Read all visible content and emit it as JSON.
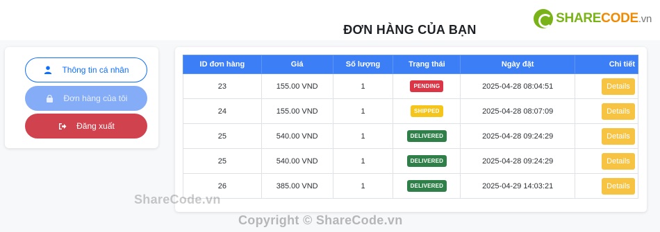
{
  "brand": {
    "share": "SHARE",
    "code": "CODE",
    "tld": ".vn"
  },
  "page": {
    "title": "ĐƠN HÀNG CỦA BẠN"
  },
  "sidebar": {
    "profile_label": "Thông tin cá nhân",
    "orders_label": "Đơn hàng của tôi",
    "logout_label": "Đăng xuất"
  },
  "table": {
    "headers": [
      "ID đơn hàng",
      "Giá",
      "Số lượng",
      "Trạng thái",
      "Ngày đặt",
      "Chi tiết"
    ],
    "rows": [
      {
        "id": "23",
        "price": "155.00 VND",
        "qty": "1",
        "status": "PENDING",
        "date": "2025-04-28 08:04:51",
        "action": "Details"
      },
      {
        "id": "24",
        "price": "155.00 VND",
        "qty": "1",
        "status": "SHIPPED",
        "date": "2025-04-28 08:07:09",
        "action": "Details"
      },
      {
        "id": "25",
        "price": "540.00 VND",
        "qty": "1",
        "status": "DELIVERED",
        "date": "2025-04-28 09:24:29",
        "action": "Details"
      },
      {
        "id": "25",
        "price": "540.00 VND",
        "qty": "1",
        "status": "DELIVERED",
        "date": "2025-04-28 09:24:29",
        "action": "Details"
      },
      {
        "id": "26",
        "price": "385.00 VND",
        "qty": "1",
        "status": "DELIVERED",
        "date": "2025-04-29 14:03:21",
        "action": "Details"
      }
    ]
  },
  "watermarks": {
    "left": "ShareCode.vn",
    "bottom": "Copyright © ShareCode.vn"
  },
  "colors": {
    "primary": "#3b7ef6",
    "pending": "#dc3545",
    "shipped": "#f5c51c",
    "delivered": "#2e8048",
    "details": "#f6c342",
    "logout": "#d1424f"
  }
}
